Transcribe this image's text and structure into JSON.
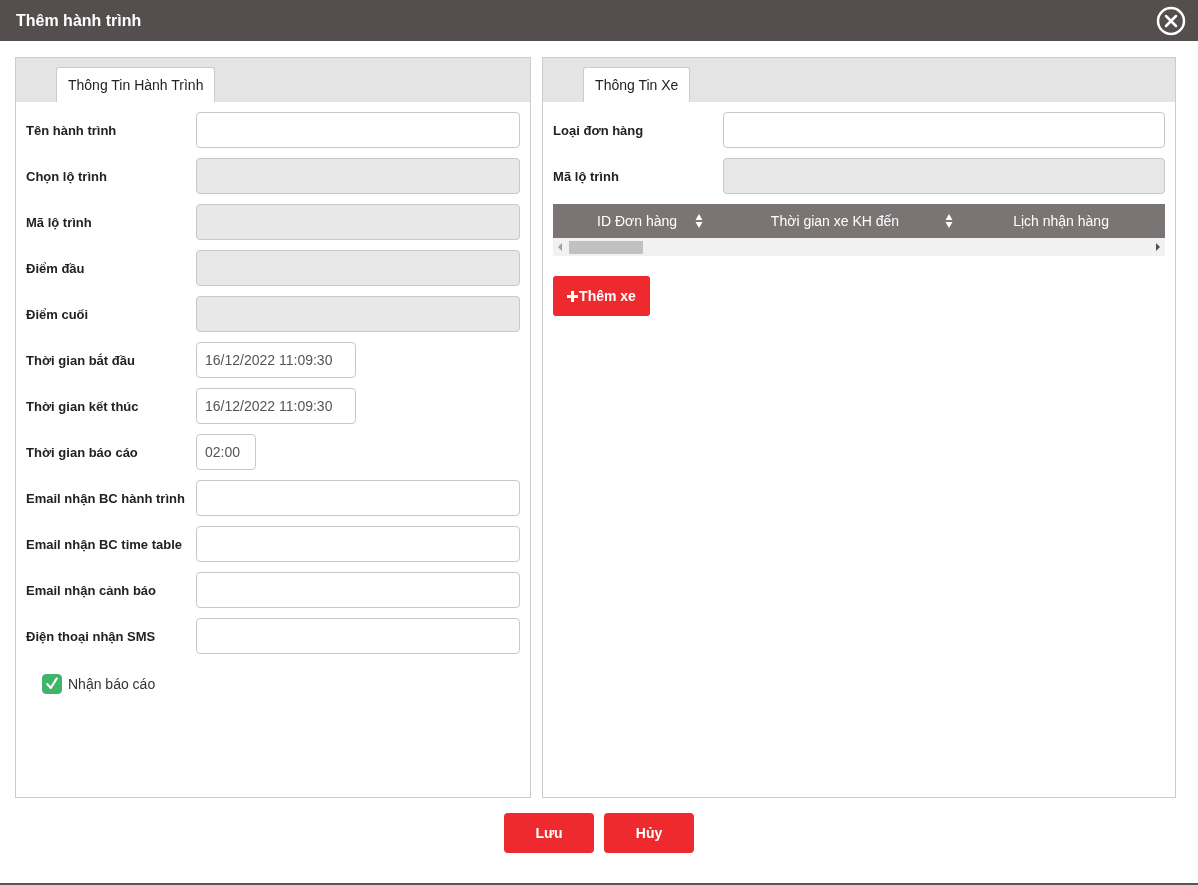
{
  "window": {
    "title": "Thêm hành trình"
  },
  "left_panel": {
    "tabs": [
      {
        "label": "Thông Tin Hành Trình",
        "selected": true
      }
    ],
    "fields": [
      {
        "label": "Tên hành trình",
        "kind": "text"
      },
      {
        "label": "Chọn lộ trình",
        "kind": "disabled"
      },
      {
        "label": "Mã lộ trình",
        "kind": "disabled"
      },
      {
        "label": "Điểm đầu",
        "kind": "disabled"
      },
      {
        "label": "Điểm cuối",
        "kind": "disabled"
      },
      {
        "label": "Thời gian bắt đầu",
        "kind": "datetime",
        "value": "16/12/2022 11:09:30"
      },
      {
        "label": "Thời gian kết thúc",
        "kind": "datetime",
        "value": "16/12/2022 11:09:30"
      },
      {
        "label": "Thời gian báo cáo",
        "kind": "time",
        "value": "02:00"
      },
      {
        "label": "Email nhận BC hành trình",
        "kind": "text"
      },
      {
        "label": "Email nhận BC time table",
        "kind": "text"
      },
      {
        "label": "Email nhận cảnh báo",
        "kind": "text"
      },
      {
        "label": "Điện thoại nhận SMS",
        "kind": "text"
      }
    ],
    "checkbox": {
      "label": "Nhận báo cáo",
      "checked": true
    }
  },
  "right_panel": {
    "tabs": [
      {
        "label": "Thông Tin Xe",
        "selected": true
      }
    ],
    "fields": [
      {
        "label": "Loại đơn hàng",
        "kind": "text"
      },
      {
        "label": "Mã lộ trình",
        "kind": "disabled"
      }
    ],
    "table": {
      "columns": [
        {
          "label": "ID Đơn hàng",
          "sortable": true
        },
        {
          "label": "Thời gian xe KH đến",
          "sortable": true
        },
        {
          "label": "Lịch nhận hàng",
          "sortable": false
        }
      ]
    },
    "add_button": "Thêm xe"
  },
  "buttons": [
    "Lưu",
    "Hủy"
  ]
}
